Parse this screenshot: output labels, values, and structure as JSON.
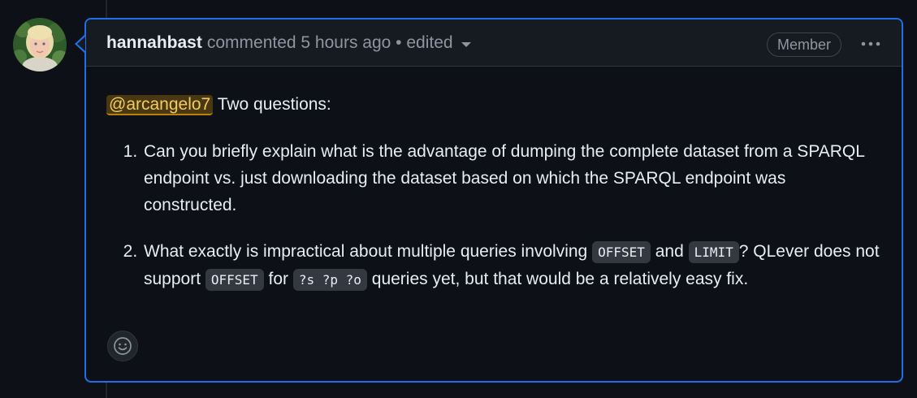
{
  "comment": {
    "author": "hannahbast",
    "meta": "commented 5 hours ago • edited",
    "badge": "Member",
    "more_icon": "kebab-horizontal-icon",
    "mention": "@arcangelo7",
    "intro": " Two questions:",
    "items": [
      {
        "text": "Can you briefly explain what is the advantage of dumping the complete dataset from a SPARQL endpoint vs. just downloading the dataset based on which the SPARQL endpoint was constructed."
      },
      {
        "text_1": "What exactly is impractical about multiple queries involving ",
        "code_1": "OFFSET",
        "text_2": " and ",
        "code_2": "LIMIT",
        "text_3": "? QLever does not support ",
        "code_3": "OFFSET",
        "text_4": " for ",
        "code_4": "?s ?p ?o",
        "text_5": " queries yet, but that would be a relatively easy fix."
      }
    ],
    "reaction_icon": "smiley-icon"
  },
  "colors": {
    "background": "#0d1117",
    "header_bg": "#161b22",
    "accent_border": "#1f6feb",
    "muted_text": "#8d96a0",
    "mention_text": "#f2cc60"
  }
}
